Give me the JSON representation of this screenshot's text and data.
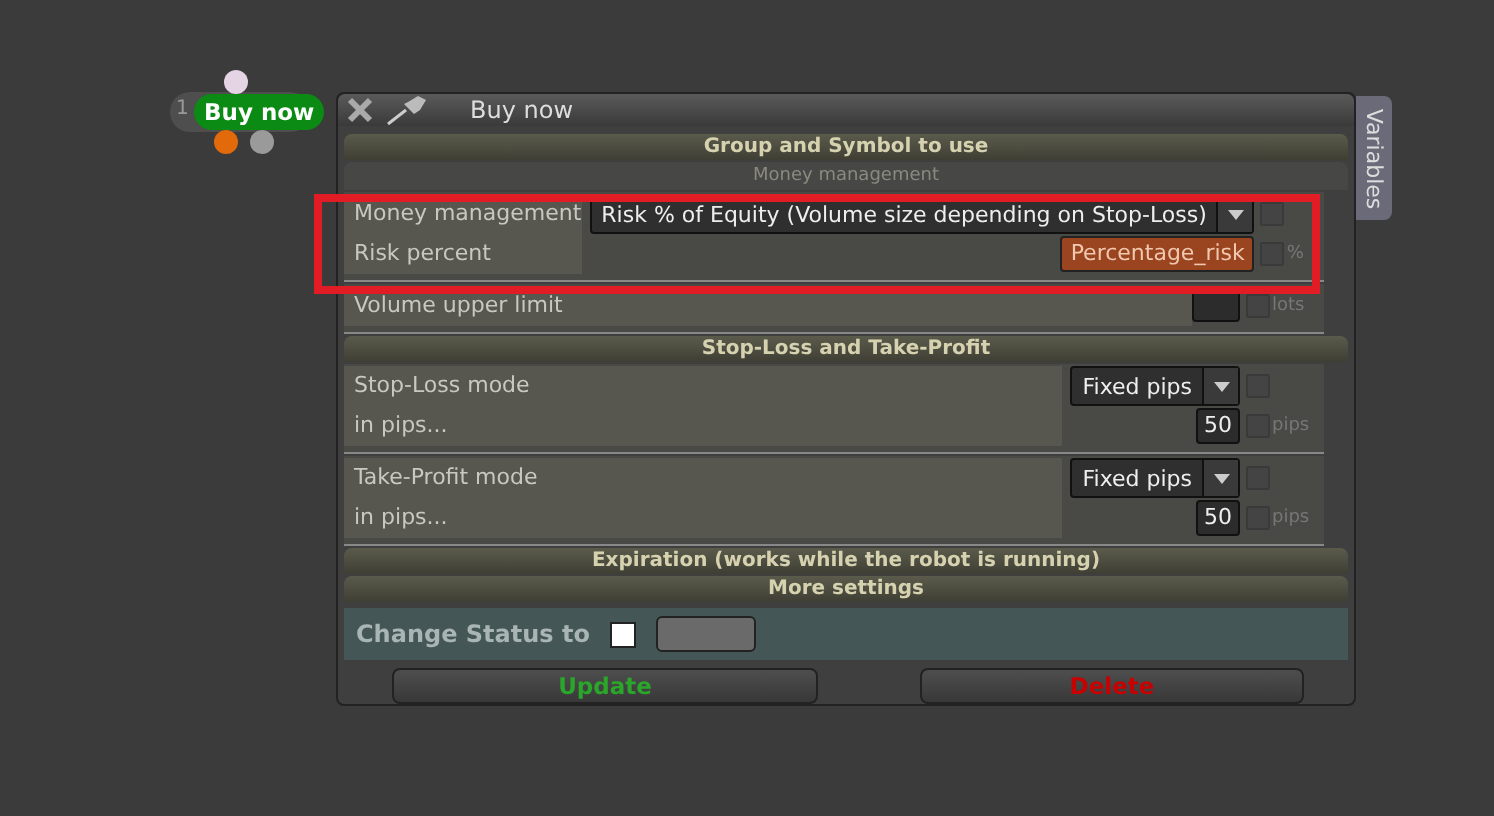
{
  "node": {
    "number": "1",
    "label": "Buy now"
  },
  "dialog": {
    "title": "Buy now",
    "side_tab": "Variables",
    "sections": [
      {
        "title": "Group and Symbol to use"
      },
      {
        "title": "Money management",
        "kind": "sub",
        "groups": [
          {
            "rows": [
              {
                "label": "Money management",
                "kind": "select",
                "value": "Risk % of Equity (Volume size depending on Stop-Loss)",
                "checked": false
              },
              {
                "label": "Risk percent",
                "kind": "variable",
                "value": "Percentage_risk",
                "unit": "%",
                "checked": false
              }
            ]
          },
          {
            "rows": [
              {
                "label": "Volume upper limit",
                "kind": "empty",
                "unit": "lots",
                "checked": false
              }
            ]
          }
        ]
      },
      {
        "title": "Stop-Loss and Take-Profit",
        "kind": "main",
        "groups": [
          {
            "rows": [
              {
                "label": "Stop-Loss mode",
                "kind": "select",
                "value": "Fixed pips",
                "checked": false
              },
              {
                "label": "in pips...",
                "kind": "number",
                "value": "50",
                "unit": "pips",
                "checked": false
              }
            ]
          },
          {
            "rows": [
              {
                "label": "Take-Profit mode",
                "kind": "select",
                "value": "Fixed pips",
                "checked": false
              },
              {
                "label": "in pips...",
                "kind": "number",
                "value": "50",
                "unit": "pips",
                "checked": false
              }
            ]
          }
        ]
      },
      {
        "title": "Expiration (works while the robot is running)"
      },
      {
        "title": "More settings"
      }
    ],
    "status": {
      "label": "Change Status to",
      "checked": false
    },
    "buttons": [
      {
        "label": "Update",
        "kind": "update"
      },
      {
        "label": "Delete",
        "kind": "delete"
      }
    ]
  }
}
